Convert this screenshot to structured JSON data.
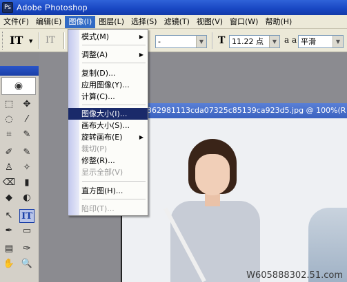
{
  "window": {
    "title": "Adobe Photoshop",
    "logo_text": "Ps"
  },
  "menubar": {
    "items": [
      {
        "label": "文件(F)"
      },
      {
        "label": "编辑(E)"
      },
      {
        "label": "图像(I)"
      },
      {
        "label": "图层(L)"
      },
      {
        "label": "选择(S)"
      },
      {
        "label": "滤镜(T)"
      },
      {
        "label": "视图(V)"
      },
      {
        "label": "窗口(W)"
      },
      {
        "label": "帮助(H)"
      }
    ],
    "active_index": 2
  },
  "options": {
    "tool_icon": "IT",
    "tool_icon_2": "IT",
    "font_style": "-",
    "size_icon": "T",
    "font_size": "11.22 点",
    "aa_icon": "a a",
    "antialias": "平滑"
  },
  "image_menu": {
    "items": [
      {
        "label": "模式(M)",
        "submenu": true
      },
      {
        "label": "调整(A)",
        "submenu": true
      },
      {
        "label": "复制(D)..."
      },
      {
        "label": "应用图像(Y)..."
      },
      {
        "label": "计算(C)..."
      },
      {
        "label": "图像大小(I)...",
        "highlighted": true
      },
      {
        "label": "画布大小(S)..."
      },
      {
        "label": "旋转画布(E)",
        "submenu": true
      },
      {
        "label": "裁切(P)",
        "disabled": true
      },
      {
        "label": "修整(R)..."
      },
      {
        "label": "显示全部(V)",
        "disabled": true
      },
      {
        "label": "直方图(H)..."
      },
      {
        "label": "陷印(T)...",
        "disabled": true
      }
    ],
    "submenu_arrow": "▶"
  },
  "document": {
    "title": "362981113cda07325c85139ca923d5.jpg @ 100%(R"
  },
  "toolbox": {
    "eye_icon": "◉",
    "tools": [
      "⬚",
      "✥",
      "◌",
      "⁄",
      "⌗",
      "✎",
      "✐",
      "✎",
      "♙",
      "✧",
      "⌫",
      "▮",
      "◆",
      "◐",
      "↖",
      "IT",
      "✒",
      "▭",
      "▤",
      "✑",
      "✋",
      "🔍"
    ]
  },
  "watermark": "W605888302.51.com"
}
